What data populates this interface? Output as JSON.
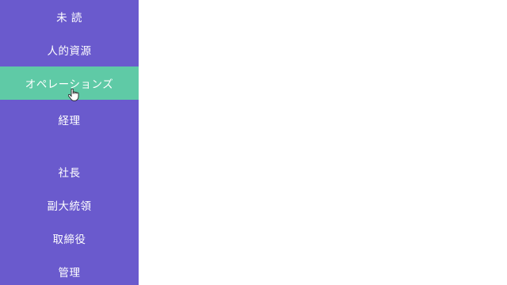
{
  "sidebar": {
    "items": [
      {
        "label": "未 読"
      },
      {
        "label": "人的資源"
      },
      {
        "label": "オペレーションズ",
        "active": true
      },
      {
        "label": "経理"
      },
      {
        "label": "社長"
      },
      {
        "label": "副大統領"
      },
      {
        "label": "取締役"
      },
      {
        "label": "管理"
      }
    ]
  },
  "colors": {
    "sidebar_bg": "#6a5acd",
    "active_bg": "#5fcaa6",
    "text": "#ffffff"
  },
  "cursor": {
    "icon": "hand-pointer-icon"
  }
}
